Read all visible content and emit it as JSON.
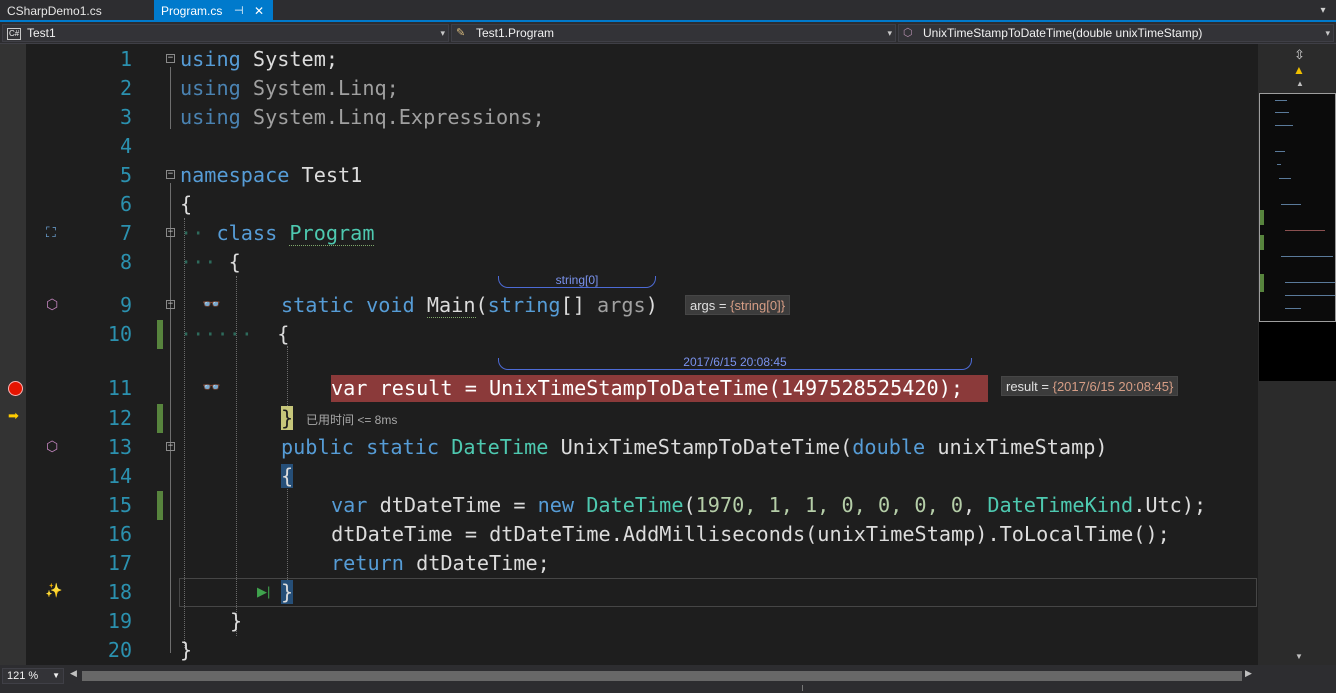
{
  "tabs": [
    {
      "label": "CSharpDemo1.cs",
      "active": false
    },
    {
      "label": "Program.cs",
      "active": true,
      "pin": "⊣",
      "close": "✕"
    }
  ],
  "navbar": {
    "project": "Test1",
    "project_icon": "C#",
    "class": "Test1.Program",
    "member": "UnixTimeStampToDateTime(double unixTimeStamp)"
  },
  "lines": [
    "1",
    "2",
    "3",
    "4",
    "5",
    "6",
    "7",
    "8",
    "9",
    "10",
    "11",
    "12",
    "13",
    "14",
    "15",
    "16",
    "17",
    "18",
    "19",
    "20"
  ],
  "code": {
    "l1": {
      "kw": "using",
      "rest": " System;"
    },
    "l2": {
      "kw": "using",
      "rest": " System.Linq;"
    },
    "l3": {
      "kw": "using",
      "rest": " System.Linq.Expressions;"
    },
    "l5": {
      "kw": "namespace",
      "rest": " Test1"
    },
    "l6": "{",
    "l7": {
      "kw": "class",
      "name": "Program"
    },
    "l8": "{",
    "l9": {
      "kw1": "static",
      "kw2": "void",
      "name": "Main",
      "open": "(",
      "kw3": "string",
      "arr": "[]",
      "param": " args",
      "close": ")"
    },
    "l10": "{",
    "l11": {
      "kw": "var",
      "rest": " result = UnixTimeStampToDateTime(1497528525420);"
    },
    "l12": "}",
    "l13": {
      "kw1": "public",
      "kw2": "static",
      "type": "DateTime",
      "rest": " UnixTimeStampToDateTime(",
      "kw3": "double",
      "param": " unixTimeStamp)"
    },
    "l14": "{",
    "l15": {
      "kw": "var",
      "p1": " dtDateTime = ",
      "kw2": "new",
      "sp": " ",
      "type": "DateTime",
      "p2": "(",
      "nums": "1970, 1, 1, 0, 0, 0, 0",
      "p3": ", ",
      "type2": "DateTimeKind",
      "p4": ".Utc);"
    },
    "l16": " dtDateTime = dtDateTime.AddMilliseconds(unixTimeStamp).ToLocalTime();",
    "l17": {
      "kw": "return",
      "rest": " dtDateTime;"
    },
    "l18": "}",
    "l19": "}",
    "l20": "}"
  },
  "debug": {
    "args_adornment": "string[0]",
    "args_tip_label": "args = ",
    "args_tip_value": "{string[0]}",
    "result_adornment": "2017/6/15 20:08:45",
    "result_tip_label": "result = ",
    "result_tip_value": "{2017/6/15 20:08:45}",
    "perf_tip": "已用时间 <= 8ms"
  },
  "zoom": "121 %",
  "colors": {
    "keyword": "#569cd6",
    "type": "#4ec9b0",
    "number": "#b5cea8",
    "line_number": "#2b91af",
    "breakpoint": "#e51400",
    "breakpoint_line": "#8b3a3a",
    "accent": "#007acc"
  }
}
